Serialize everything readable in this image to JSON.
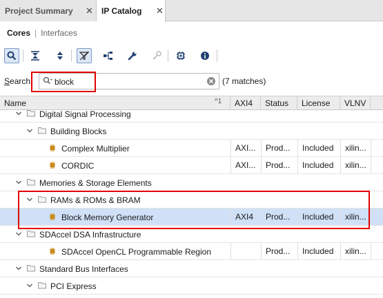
{
  "tabs": [
    {
      "label": "Project Summary",
      "close": "✕"
    },
    {
      "label": "IP Catalog",
      "close": "✕"
    }
  ],
  "subtabs": {
    "active": "Cores",
    "separator": "|",
    "inactive": "Interfaces"
  },
  "toolbar": {
    "icons": [
      "search-icon",
      "collapse-all-icon",
      "expand-all-icon",
      "filter-icon",
      "hierarchy-icon",
      "wrench-icon",
      "key-icon",
      "chip-icon",
      "info-icon"
    ]
  },
  "search": {
    "label_underlined": "S",
    "label_rest": "earch",
    "value": "block",
    "matches": "(7 matches)"
  },
  "columns": {
    "name": "Name",
    "sort": "^1",
    "axi": "AXI4",
    "status": "Status",
    "license": "License",
    "vlnv": "VLNV"
  },
  "rows": [
    {
      "name": "Digital Signal Processing",
      "type": "folder",
      "level": 0
    },
    {
      "name": "Building Blocks",
      "type": "folder",
      "level": 1
    },
    {
      "name": "Complex Multiplier",
      "type": "ip",
      "level": 2,
      "axi": "AXI...",
      "status": "Prod...",
      "license": "Included",
      "vlnv": "xilin..."
    },
    {
      "name": "CORDIC",
      "type": "ip",
      "level": 2,
      "axi": "AXI...",
      "status": "Prod...",
      "license": "Included",
      "vlnv": "xilin..."
    },
    {
      "name": "Memories & Storage Elements",
      "type": "folder",
      "level": 0
    },
    {
      "name": "RAMs & ROMs & BRAM",
      "type": "folder",
      "level": 1
    },
    {
      "name": "Block Memory Generator",
      "type": "ip",
      "level": 2,
      "axi": "AXI4",
      "status": "Prod...",
      "license": "Included",
      "vlnv": "xilin...",
      "selected": true
    },
    {
      "name": "SDAccel DSA Infrastructure",
      "type": "folder",
      "level": 0
    },
    {
      "name": "SDAccel OpenCL Programmable Region",
      "type": "ip",
      "level": 1,
      "axi": "",
      "status": "Prod...",
      "license": "Included",
      "vlnv": "xilin..."
    },
    {
      "name": "Standard Bus Interfaces",
      "type": "folder",
      "level": 0
    },
    {
      "name": "PCI Express",
      "type": "folder",
      "level": 1
    }
  ],
  "colors": {
    "highlight_box": "#e00000",
    "selected_row": "#cfe0f7",
    "ip_icon": "#c98a1a"
  }
}
